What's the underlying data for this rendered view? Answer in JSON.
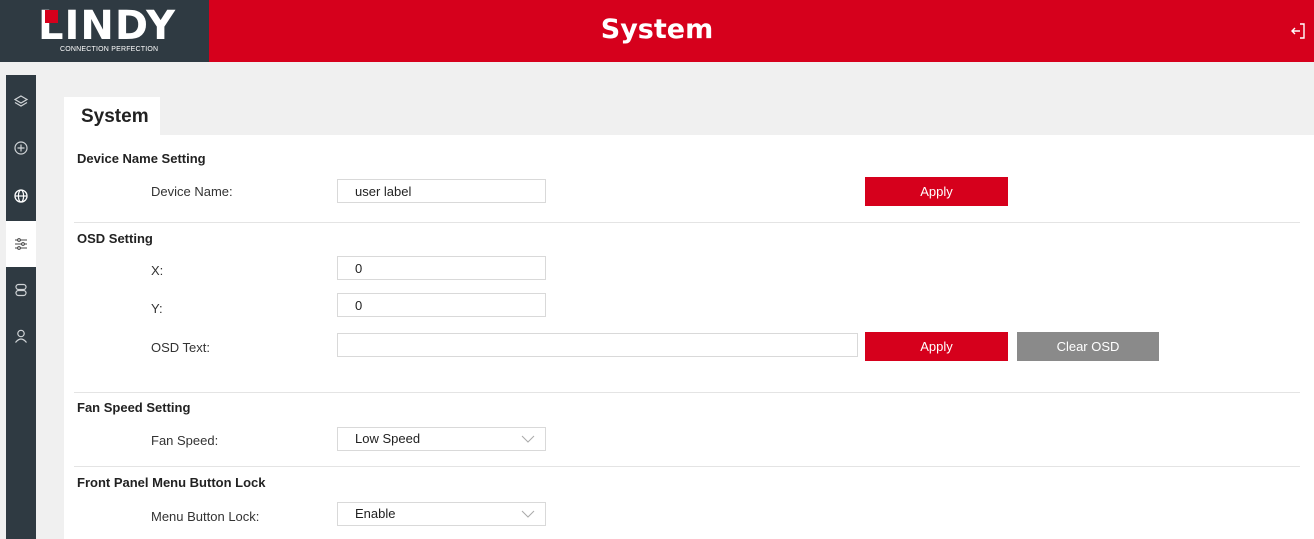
{
  "header": {
    "logo_text": "LINDY",
    "logo_tagline": "CONNECTION PERFECTION",
    "page_title": "System",
    "accent_color": "#d6001c",
    "dark_color": "#2f3a42"
  },
  "sidebar": {
    "items": [
      {
        "icon": "layers-icon"
      },
      {
        "icon": "move-icon"
      },
      {
        "icon": "globe-icon"
      },
      {
        "icon": "sliders-icon",
        "active": true
      },
      {
        "icon": "server-icon"
      },
      {
        "icon": "user-icon"
      }
    ]
  },
  "tab": {
    "label": "System"
  },
  "device_name_setting": {
    "title": "Device Name Setting",
    "label": "Device Name:",
    "value": "user label",
    "apply_label": "Apply"
  },
  "osd_setting": {
    "title": "OSD Setting",
    "x_label": "X:",
    "x_value": "0",
    "y_label": "Y:",
    "y_value": "0",
    "text_label": "OSD Text:",
    "text_value": "",
    "apply_label": "Apply",
    "clear_label": "Clear OSD"
  },
  "fan_speed_setting": {
    "title": "Fan Speed Setting",
    "label": "Fan Speed:",
    "selected": "Low Speed"
  },
  "front_panel_lock": {
    "title": "Front Panel Menu Button Lock",
    "label": "Menu Button Lock:",
    "selected": "Enable"
  }
}
